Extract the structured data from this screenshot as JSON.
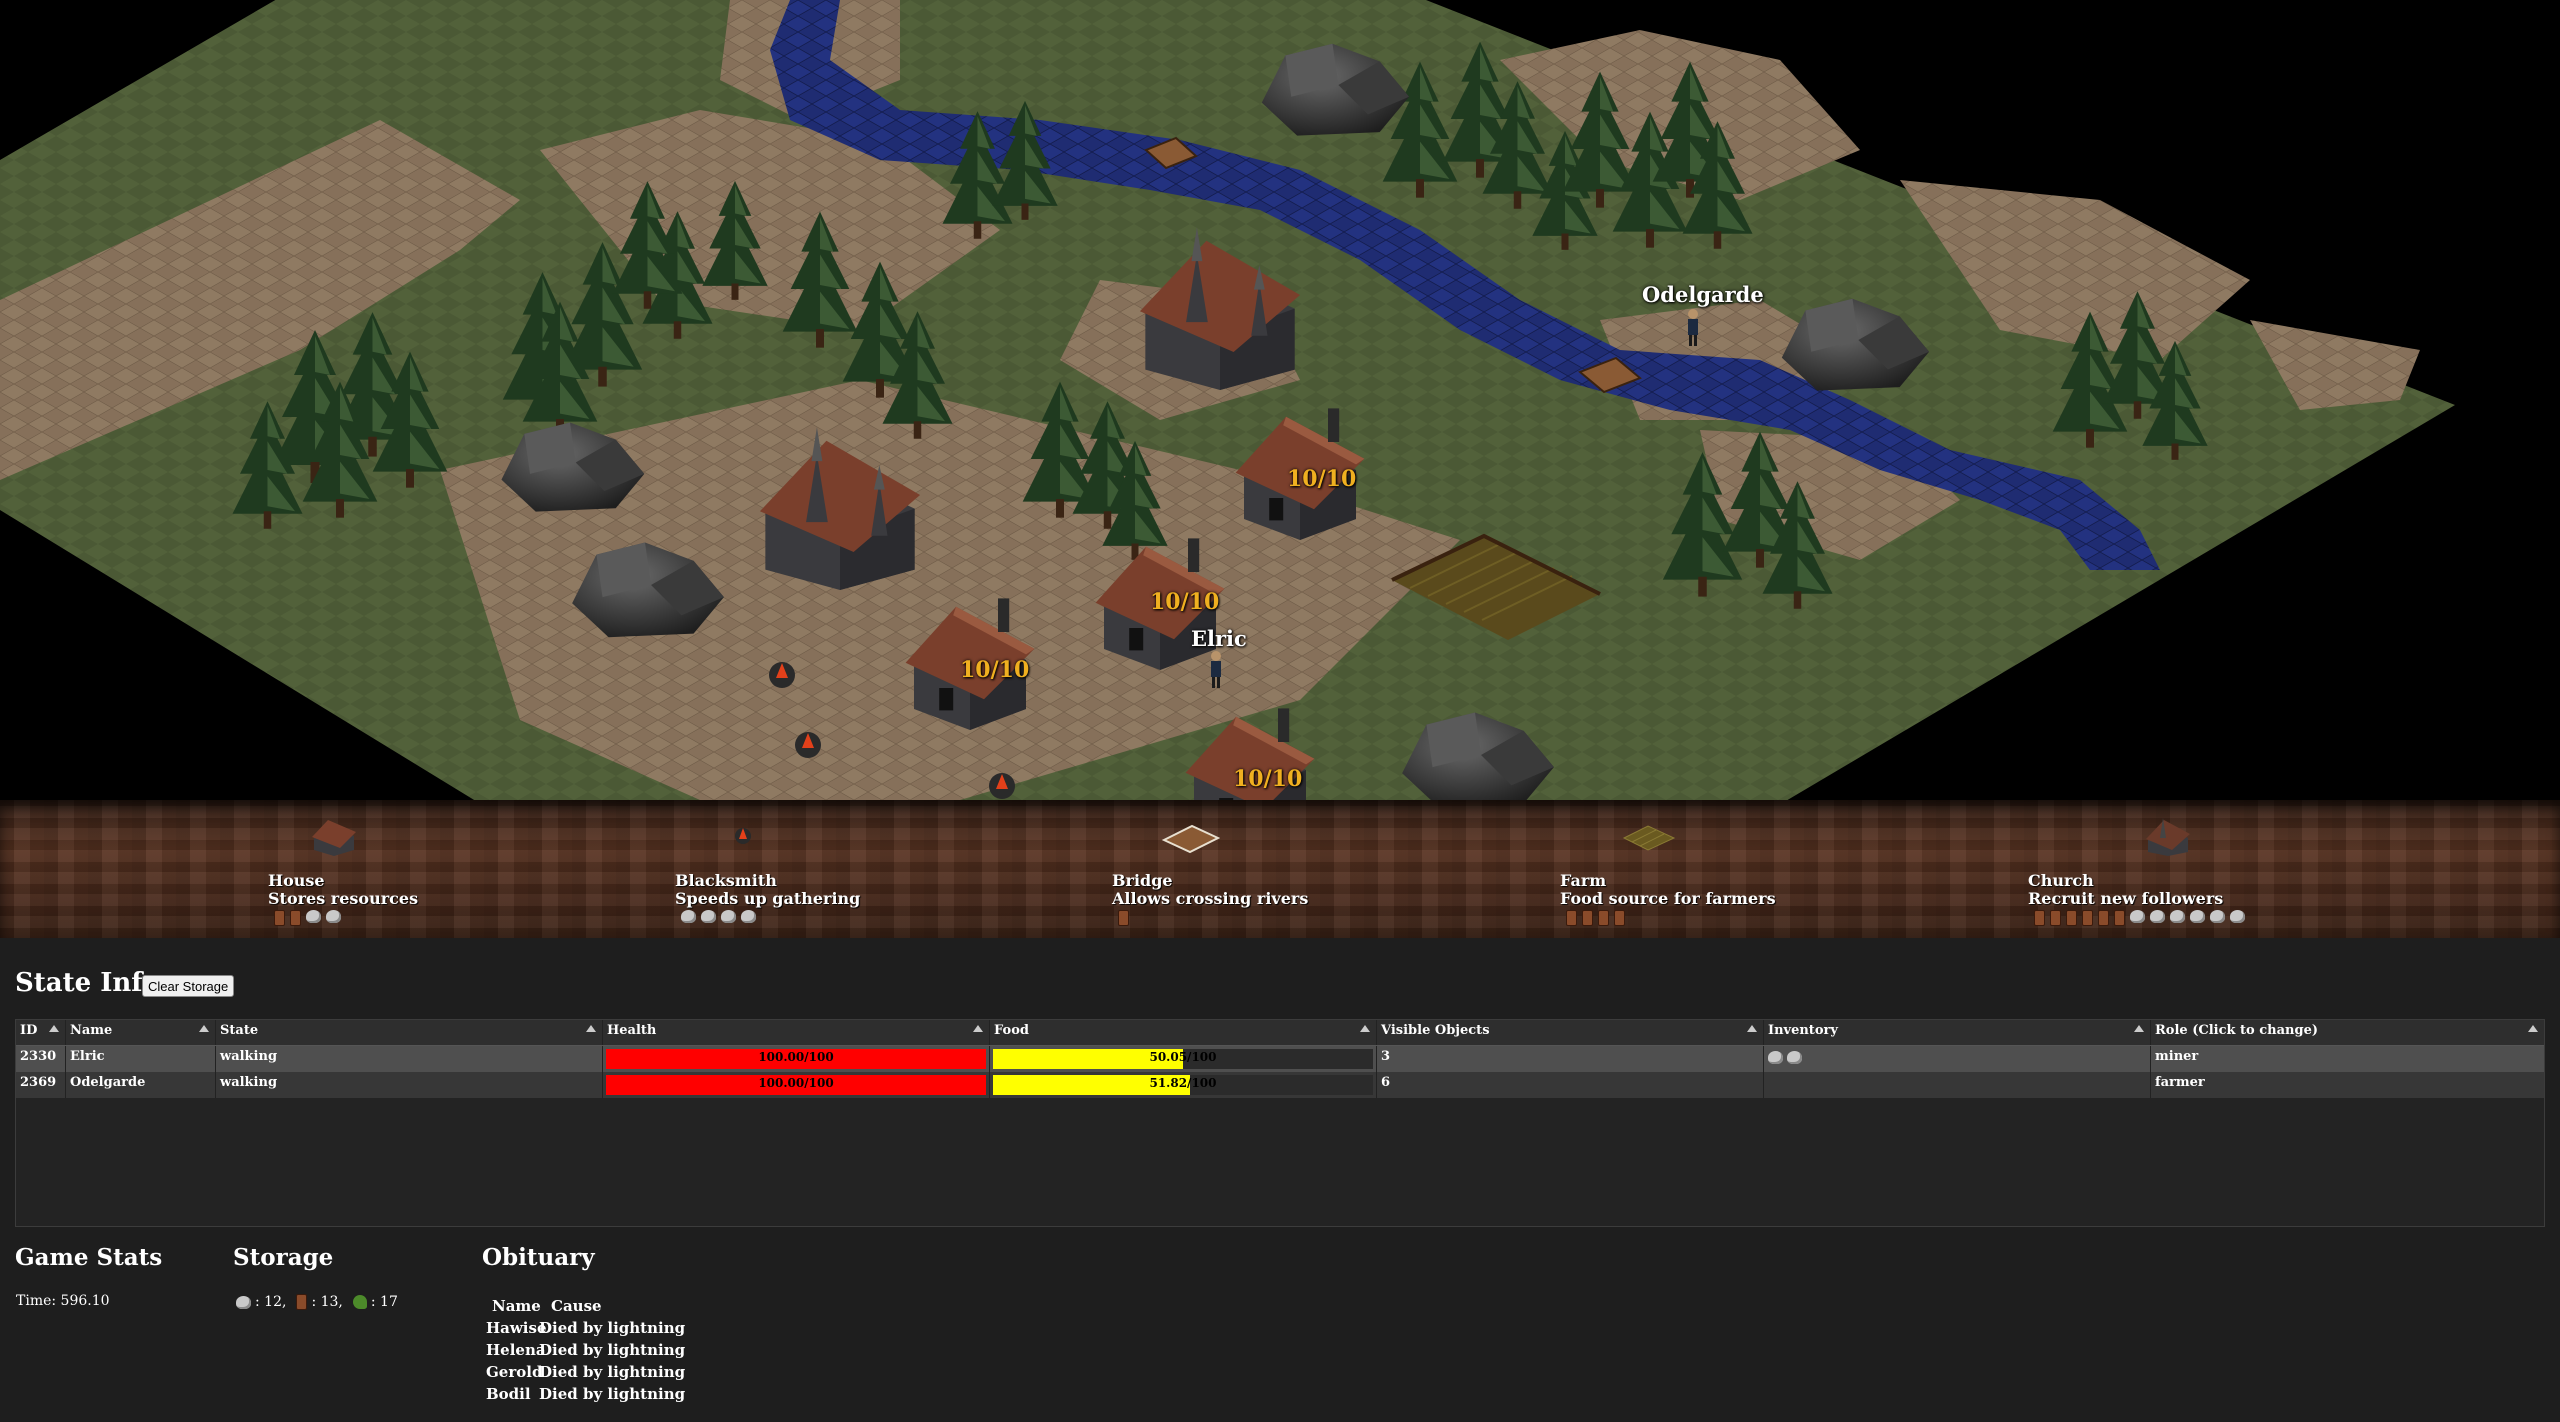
{
  "map": {
    "villagers": [
      {
        "name": "Odelgarde"
      },
      {
        "name": "Elric"
      }
    ],
    "house_occupancy": [
      "10/10",
      "10/10",
      "10/10",
      "10/10"
    ]
  },
  "build_menu": [
    {
      "name": "House",
      "description": "Stores resources",
      "cost": [
        "wood",
        "wood",
        "stone",
        "stone"
      ]
    },
    {
      "name": "Blacksmith",
      "description": "Speeds up gathering",
      "cost": [
        "stone",
        "stone",
        "stone",
        "stone"
      ]
    },
    {
      "name": "Bridge",
      "description": "Allows crossing rivers",
      "cost": [
        "wood"
      ]
    },
    {
      "name": "Farm",
      "description": "Food source for farmers",
      "cost": [
        "wood",
        "wood",
        "wood",
        "wood"
      ]
    },
    {
      "name": "Church",
      "description": "Recruit new followers",
      "cost": [
        "wood",
        "wood",
        "wood",
        "wood",
        "wood",
        "wood",
        "stone",
        "stone",
        "stone",
        "stone",
        "stone",
        "stone"
      ]
    }
  ],
  "state_info": {
    "title": "State Info",
    "clear_button": "Clear Storage",
    "columns": [
      "ID",
      "Name",
      "State",
      "Health",
      "Food",
      "Visible Objects",
      "Inventory",
      "Role (Click to change)"
    ],
    "rows": [
      {
        "id": "2330",
        "name": "Elric",
        "state": "walking",
        "health": 100.0,
        "health_max": 100,
        "health_text": "100.00/100",
        "food": 50.05,
        "food_max": 100,
        "food_text": "50.05/100",
        "visible": "3",
        "inventory": [
          "stone",
          "stone"
        ],
        "role": "miner"
      },
      {
        "id": "2369",
        "name": "Odelgarde",
        "state": "walking",
        "health": 100.0,
        "health_max": 100,
        "health_text": "100.00/100",
        "food": 51.82,
        "food_max": 100,
        "food_text": "51.82/100",
        "visible": "6",
        "inventory": [],
        "role": "farmer"
      }
    ]
  },
  "game_stats": {
    "title": "Game Stats",
    "time": "Time: 596.10"
  },
  "storage": {
    "title": "Storage",
    "stone": ": 12,",
    "wood": ": 13,",
    "food": ": 17"
  },
  "obituary": {
    "title": "Obituary",
    "headers": [
      "Name",
      "Cause"
    ],
    "entries": [
      {
        "name": "Hawise",
        "cause": "Died by lightning"
      },
      {
        "name": "Helena",
        "cause": "Died by lightning"
      },
      {
        "name": "Gerold",
        "cause": "Died by lightning"
      },
      {
        "name": "Bodil",
        "cause": "Died by lightning"
      }
    ]
  },
  "colors": {
    "health": "#ff0000",
    "food": "#ffff00",
    "grass": "#4a5a34",
    "dirt": "#8a7458",
    "water": "#1e2a6e"
  }
}
